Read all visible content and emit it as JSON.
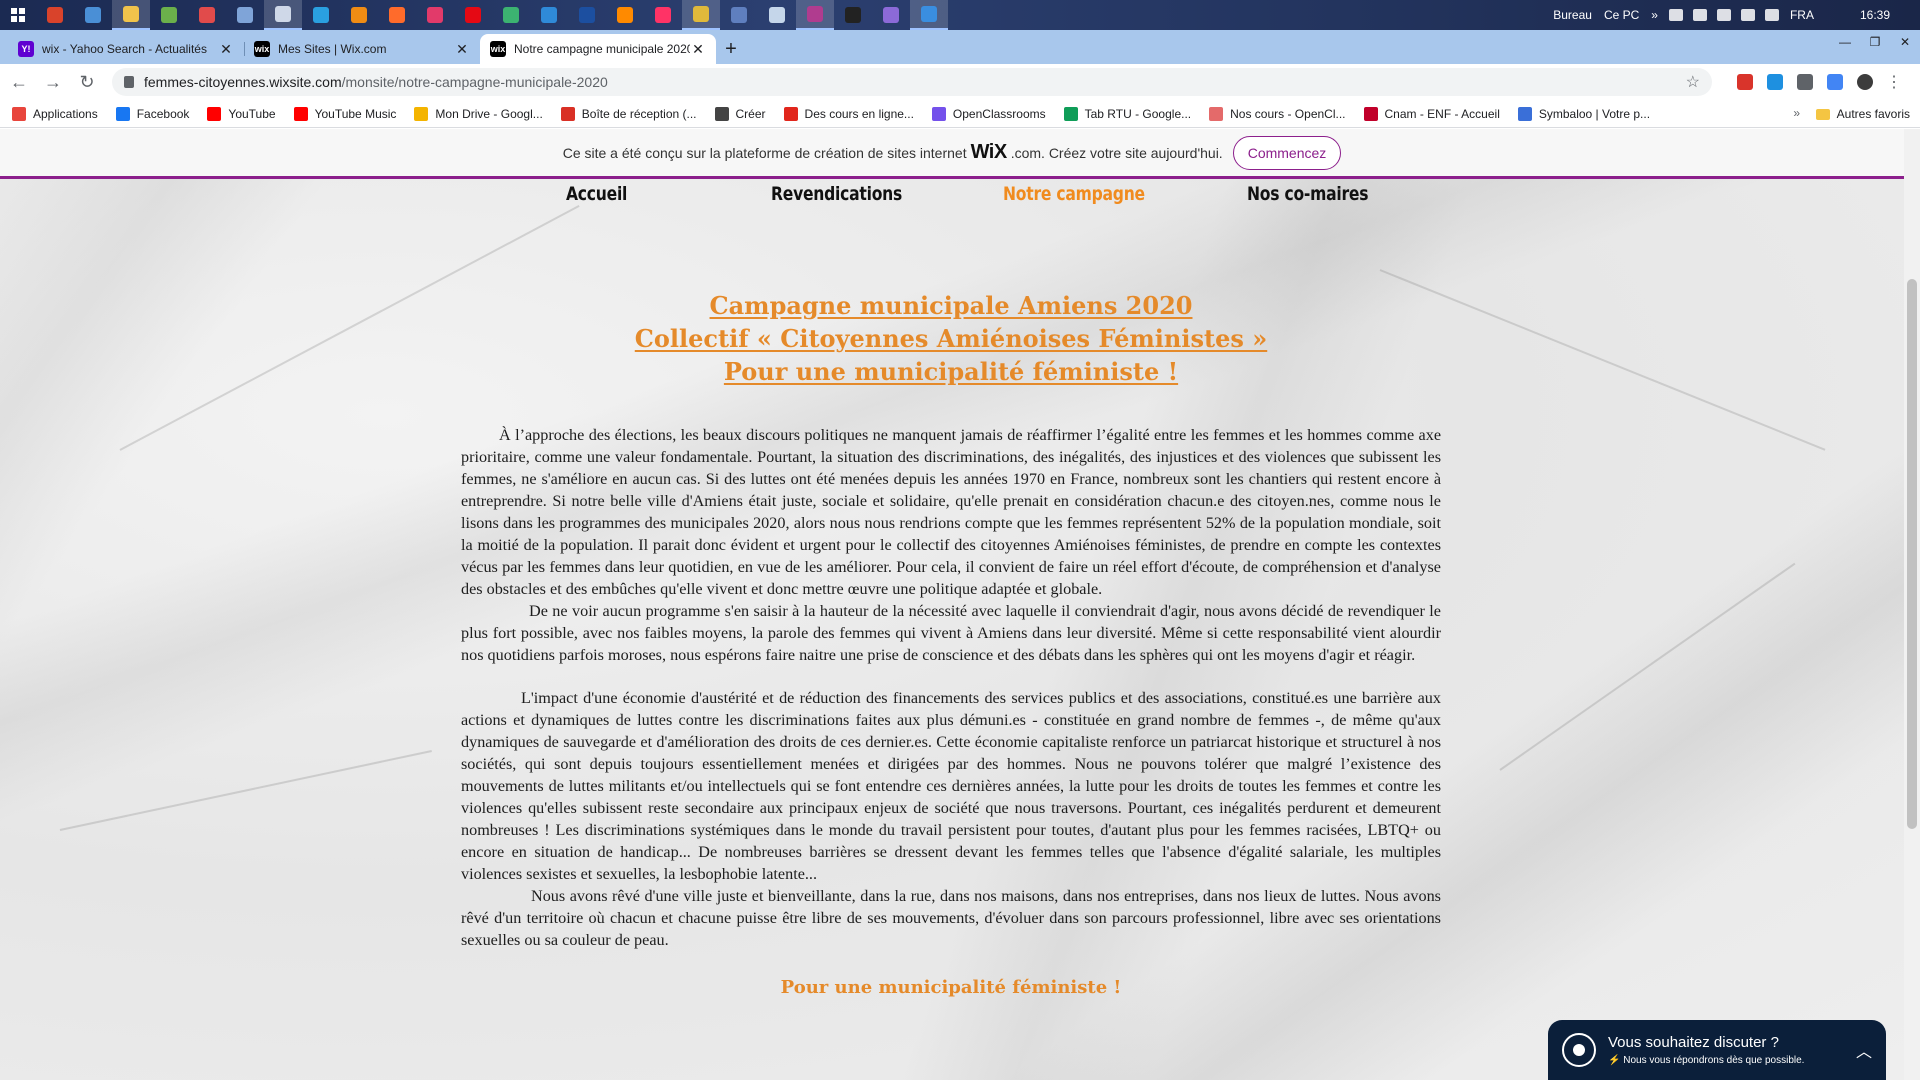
{
  "taskbar": {
    "apps": [
      {
        "icon": "app-icon-1",
        "color": "#d9432b"
      },
      {
        "icon": "app-icon-2",
        "color": "#4a8fd6"
      },
      {
        "icon": "file-explorer-icon",
        "color": "#f1c34b"
      },
      {
        "icon": "app-icon-4",
        "color": "#6bb04b"
      },
      {
        "icon": "app-icon-5",
        "color": "#e14b4b"
      },
      {
        "icon": "app-icon-6",
        "color": "#7fa4d8"
      },
      {
        "icon": "app-icon-7",
        "color": "#cfd8e8"
      },
      {
        "icon": "app-icon-8",
        "color": "#2aa0e0"
      },
      {
        "icon": "vlc-icon",
        "color": "#f08c14"
      },
      {
        "icon": "firefox-icon",
        "color": "#ff6b2b"
      },
      {
        "icon": "app-icon-11",
        "color": "#e23a6a"
      },
      {
        "icon": "netflix-icon",
        "color": "#e50914"
      },
      {
        "icon": "app-icon-13",
        "color": "#3cb371"
      },
      {
        "icon": "vscode-icon",
        "color": "#2f8ad8"
      },
      {
        "icon": "photoshop-icon",
        "color": "#1c4fa0"
      },
      {
        "icon": "illustrator-icon",
        "color": "#ff8a00"
      },
      {
        "icon": "indesign-icon",
        "color": "#ff3366"
      },
      {
        "icon": "chrome-icon",
        "color": "#e0b93b"
      },
      {
        "icon": "app-icon-19",
        "color": "#5f7fbf"
      },
      {
        "icon": "app-icon-20",
        "color": "#c5d6ea"
      },
      {
        "icon": "app-icon-21",
        "color": "#b03c8f"
      },
      {
        "icon": "app-icon-22",
        "color": "#222222"
      },
      {
        "icon": "app-icon-23",
        "color": "#8c6ad8"
      },
      {
        "icon": "app-icon-24",
        "color": "#3a8ee0"
      }
    ],
    "desktop_label": "Bureau",
    "pc_label": "Ce PC",
    "lang": "FRA",
    "time": "16:39"
  },
  "browser": {
    "tabs": [
      {
        "title": "wix - Yahoo Search - Actualités",
        "favicon": "Y!",
        "color": "#5f01d1"
      },
      {
        "title": "Mes Sites | Wix.com",
        "favicon": "wix",
        "color": "#000000"
      },
      {
        "title": "Notre campagne municipale 2020",
        "favicon": "wix",
        "color": "#000000"
      }
    ],
    "url_host": "femmes-citoyennes.wixsite.com",
    "url_path": "/monsite/notre-campagne-municipale-2020",
    "bookmarks": [
      {
        "label": "Applications",
        "icon": "apps-grid-icon",
        "color": "#e8453c"
      },
      {
        "label": "Facebook",
        "icon": "facebook-icon",
        "color": "#1877f2"
      },
      {
        "label": "YouTube",
        "icon": "youtube-icon",
        "color": "#ff0000"
      },
      {
        "label": "YouTube Music",
        "icon": "youtube-music-icon",
        "color": "#ff0000"
      },
      {
        "label": "Mon Drive - Googl...",
        "icon": "google-drive-icon",
        "color": "#f4b400"
      },
      {
        "label": "Boîte de réception (...",
        "icon": "gmail-icon",
        "color": "#d93025"
      },
      {
        "label": "Créer",
        "icon": "create-icon",
        "color": "#444444"
      },
      {
        "label": "Des cours en ligne...",
        "icon": "courses-icon",
        "color": "#e1261c"
      },
      {
        "label": "OpenClassrooms",
        "icon": "openclassrooms-icon",
        "color": "#7451eb"
      },
      {
        "label": "Tab RTU - Google...",
        "icon": "google-drive-icon",
        "color": "#0f9d58"
      },
      {
        "label": "Nos cours - OpenCl...",
        "icon": "openclassrooms-icon",
        "color": "#e46a6a"
      },
      {
        "label": "Cnam - ENF - Accueil",
        "icon": "cnam-icon",
        "color": "#c1002a"
      },
      {
        "label": "Symbaloo | Votre p...",
        "icon": "symbaloo-icon",
        "color": "#3a6fd8"
      }
    ],
    "more_bookmarks": "»",
    "other_bookmarks": "Autres favoris"
  },
  "wix_banner": {
    "text_before": "Ce site a été conçu sur la plateforme de création de sites internet",
    "logo": "WiX",
    "text_after": ".com. Créez votre site aujourd'hui.",
    "cta": "Commencez"
  },
  "site_nav": [
    {
      "label": "Accueil"
    },
    {
      "label": "Revendications"
    },
    {
      "label": "Notre campagne"
    },
    {
      "label": "Nos co-maires"
    }
  ],
  "article": {
    "heading_line1": "Campagne municipale Amiens 2020",
    "heading_line2": "Collectif « Citoyennes Amiénoises Féministes »",
    "heading_line3": "Pour une municipalité féministe !",
    "p1": "À l’approche des élections, les beaux discours politiques ne manquent jamais de réaffirmer l’égalité entre les femmes et les hommes comme axe prioritaire, comme une valeur fondamentale. Pourtant, la situation des discriminations, des inégalités, des injustices et des violences que subissent les femmes, ne s'améliore en aucun cas. Si des luttes ont été menées depuis les années 1970 en France, nombreux sont les chantiers qui restent encore à entreprendre. Si notre belle ville d'Amiens était juste, sociale et solidaire, qu'elle prenait en considération chacun.e des citoyen.nes, comme nous le lisons dans les programmes des municipales 2020, alors nous nous rendrions compte que les femmes représentent 52% de la population mondiale, soit la moitié de la population. Il parait donc évident et urgent pour le collectif des citoyennes Amiénoises féministes, de prendre en compte les contextes vécus par les femmes dans leur quotidien, en vue de les améliorer. Pour cela, il convient de faire un réel effort d'écoute, de compréhension et d'analyse des obstacles et des embûches qu'elle vivent et donc mettre œuvre une politique adaptée et globale.",
    "p2": "De ne voir aucun programme s'en saisir à la hauteur de la nécessité avec laquelle il conviendrait d'agir, nous avons décidé de revendiquer le plus fort possible, avec nos faibles moyens, la parole des femmes qui vivent à Amiens dans leur diversité. Même si cette responsabilité vient alourdir nos quotidiens parfois moroses, nous espérons faire naitre une prise de conscience et des débats dans les sphères qui ont les moyens d'agir et réagir.",
    "p3": "L'impact d'une économie d'austérité et de réduction des financements des services publics et des associations, constitué.es une barrière aux actions et dynamiques de luttes contre les discriminations faites aux plus démuni.es - constituée en grand nombre de femmes -, de même qu'aux dynamiques de sauvegarde et d'amélioration des droits de ces dernier.es. Cette économie capitaliste renforce un patriarcat historique et structurel à nos sociétés, qui sont depuis toujours essentiellement menées et dirigées par des hommes. Nous ne pouvons tolérer que malgré l’existence des mouvements de luttes militants et/ou intellectuels qui se font entendre ces dernières années, la lutte pour les droits de toutes les femmes et contre les violences qu'elles subissent reste secondaire aux principaux enjeux de société que nous traversons. Pourtant, ces inégalités perdurent et demeurent nombreuses ! Les discriminations systémiques dans le monde du travail persistent pour toutes, d'autant plus pour les femmes racisées, LBTQ+ ou encore en situation de handicap... De nombreuses barrières se dressent devant les femmes telles que l'absence d'égalité salariale, les multiples violences sexistes et sexuelles, la lesbophobie latente...",
    "p4": "Nous avons rêvé d'une ville juste et bienveillante, dans la rue, dans nos maisons, dans nos entreprises, dans nos lieux de luttes. Nous avons rêvé d'un territoire où chacun et chacune puisse être libre de ses mouvements, d'évoluer dans son parcours professionnel, libre avec ses orientations sexuelles ou sa couleur de peau.",
    "closing": "Pour une municipalité féministe !"
  },
  "chat": {
    "title": "Vous souhaitez discuter ?",
    "subtitle": "Nous vous répondrons dès que possible."
  },
  "colors": {
    "accent_orange": "#e58a2a",
    "wix_purple": "#8c1f8c",
    "chat_bg": "#0b1f3a"
  }
}
